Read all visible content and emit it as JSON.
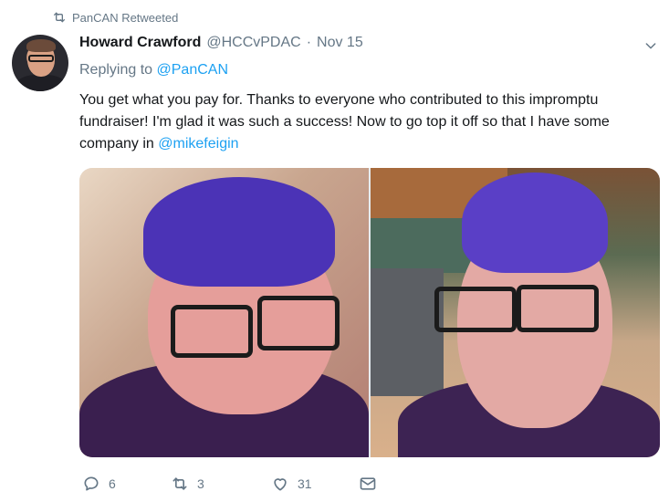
{
  "retweet_context": {
    "label": "PanCAN Retweeted",
    "icon": "retweet-icon"
  },
  "tweet": {
    "author_name": "Howard Crawford",
    "author_handle": "@HCCvPDAC",
    "separator": "·",
    "date": "Nov 15",
    "replying_prefix": "Replying to",
    "replying_to": "@PanCAN",
    "text_before_mention": "You get what you pay for. Thanks to everyone who contributed to this impromptu fundraiser! I'm glad it was such a success! Now to go top it off so that I have some company in",
    "text_mention": "@mikefeigin",
    "photos": [
      {
        "name": "photo-left",
        "description_icon": "photo"
      },
      {
        "name": "photo-right",
        "description_icon": "photo"
      }
    ]
  },
  "actions": {
    "reply_count": "6",
    "retweet_count": "3",
    "like_count": "31"
  },
  "colors": {
    "link": "#1da1f2",
    "muted": "#657786",
    "text": "#14171a"
  }
}
